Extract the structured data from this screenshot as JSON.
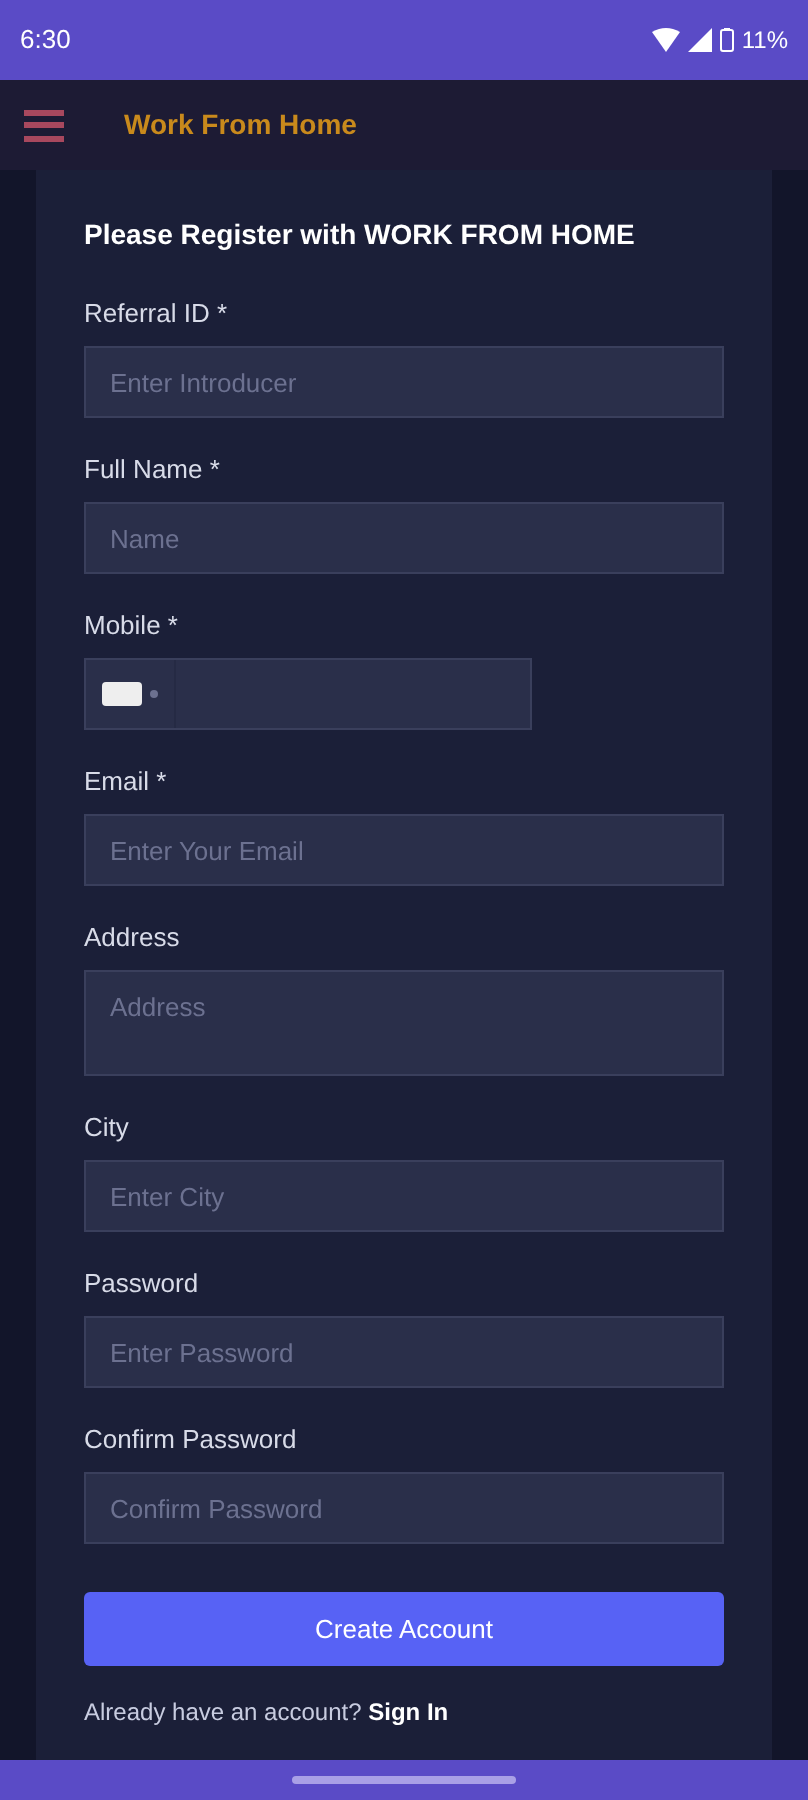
{
  "status_bar": {
    "time": "6:30",
    "battery": "11%"
  },
  "app_bar": {
    "title": "Work From Home"
  },
  "form": {
    "heading": "Please Register with WORK FROM HOME",
    "fields": [
      {
        "kind": "text",
        "label": "Referral ID *",
        "placeholder": "Enter Introducer"
      },
      {
        "kind": "text",
        "label": "Full Name *",
        "placeholder": "Name"
      },
      {
        "kind": "phone",
        "label": "Mobile *"
      },
      {
        "kind": "text",
        "label": "Email *",
        "placeholder": "Enter Your Email"
      },
      {
        "kind": "textarea",
        "label": "Address",
        "placeholder": "Address"
      },
      {
        "kind": "text",
        "label": "City",
        "placeholder": "Enter City"
      },
      {
        "kind": "text",
        "label": "Password",
        "placeholder": "Enter Password"
      },
      {
        "kind": "text",
        "label": "Confirm Password",
        "placeholder": "Confirm Password"
      }
    ],
    "submit": "Create Account",
    "footer": {
      "text": "Already have an account?",
      "link": "Sign In"
    }
  }
}
